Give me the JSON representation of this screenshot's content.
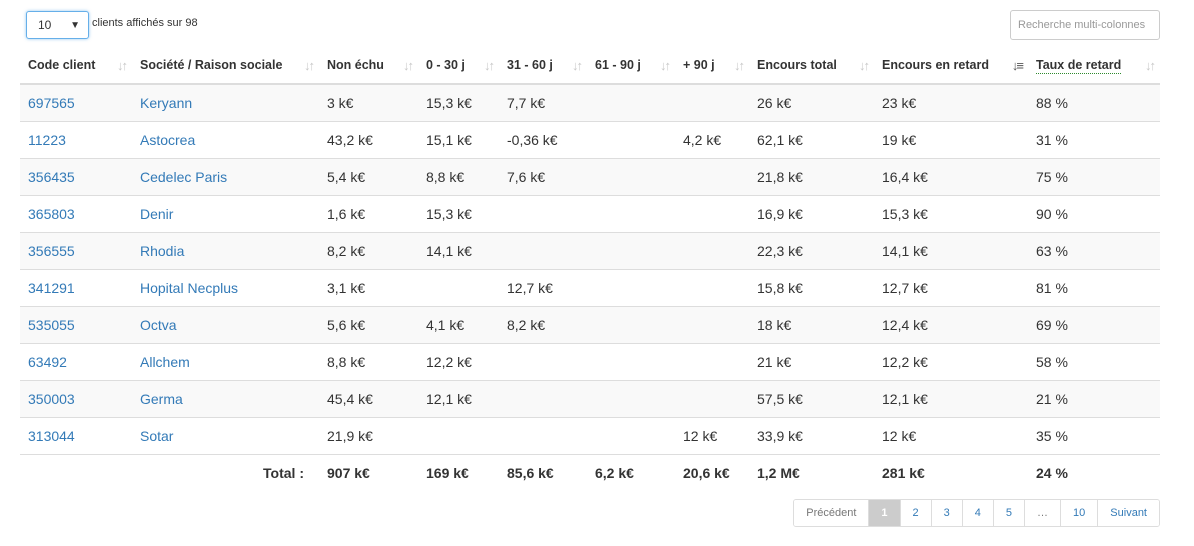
{
  "length_menu": {
    "value": "10",
    "label": "clients affichés sur 98"
  },
  "search": {
    "placeholder": "Recherche multi-colonnes"
  },
  "columns": [
    "Code client",
    "Société / Raison sociale",
    "Non échu",
    "0 - 30 j",
    "31 - 60 j",
    "61 - 90 j",
    "+ 90 j",
    "Encours total",
    "Encours en retard",
    "Taux de retard"
  ],
  "rows": [
    [
      "697565",
      "Keryann",
      "3 k€",
      "15,3 k€",
      "7,7 k€",
      "",
      "",
      "26 k€",
      "23 k€",
      "88 %"
    ],
    [
      "11223",
      "Astocrea",
      "43,2 k€",
      "15,1 k€",
      "-0,36 k€",
      "",
      "4,2 k€",
      "62,1 k€",
      "19 k€",
      "31 %"
    ],
    [
      "356435",
      "Cedelec Paris",
      "5,4 k€",
      "8,8 k€",
      "7,6 k€",
      "",
      "",
      "21,8 k€",
      "16,4 k€",
      "75 %"
    ],
    [
      "365803",
      "Denir",
      "1,6 k€",
      "15,3 k€",
      "",
      "",
      "",
      "16,9 k€",
      "15,3 k€",
      "90 %"
    ],
    [
      "356555",
      "Rhodia",
      "8,2 k€",
      "14,1 k€",
      "",
      "",
      "",
      "22,3 k€",
      "14,1 k€",
      "63 %"
    ],
    [
      "341291",
      "Hopital Necplus",
      "3,1 k€",
      "",
      "12,7 k€",
      "",
      "",
      "15,8 k€",
      "12,7 k€",
      "81 %"
    ],
    [
      "535055",
      "Octva",
      "5,6 k€",
      "4,1 k€",
      "8,2 k€",
      "",
      "",
      "18 k€",
      "12,4 k€",
      "69 %"
    ],
    [
      "63492",
      "Allchem",
      "8,8 k€",
      "12,2 k€",
      "",
      "",
      "",
      "21 k€",
      "12,2 k€",
      "58 %"
    ],
    [
      "350003",
      "Germa",
      "45,4 k€",
      "12,1 k€",
      "",
      "",
      "",
      "57,5 k€",
      "12,1 k€",
      "21 %"
    ],
    [
      "313044",
      "Sotar",
      "21,9 k€",
      "",
      "",
      "",
      "12 k€",
      "33,9 k€",
      "12 k€",
      "35 %"
    ]
  ],
  "totals": {
    "label": "Total :",
    "values": [
      "907 k€",
      "169 k€",
      "85,6 k€",
      "6,2 k€",
      "20,6 k€",
      "1,2 M€",
      "281 k€",
      "24 %"
    ]
  },
  "pagination": {
    "prev": "Précédent",
    "pages": [
      "1",
      "2",
      "3",
      "4",
      "5",
      "…",
      "10"
    ],
    "current": "1",
    "next": "Suivant"
  },
  "colors": {
    "link": "#337ab7",
    "stripe": "#f9f9f9",
    "border": "#dddddd",
    "focus": "#66afe9"
  }
}
